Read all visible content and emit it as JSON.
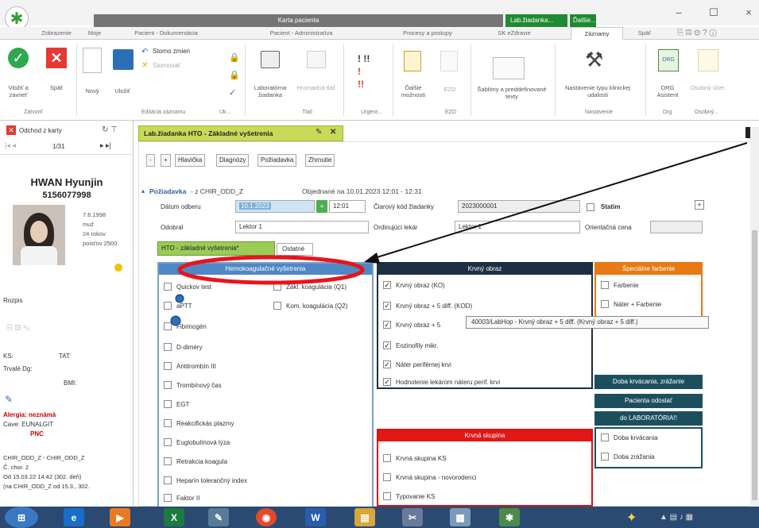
{
  "window": {
    "title": "Karta pacienta",
    "ctx_tab1": "Lab.žiadanka...",
    "ctx_tab2": "Ďalšie..."
  },
  "tabs": [
    "Zobrazenie",
    "Moje",
    "Pacient - Dokumentácia",
    "Pacient - Administratíva",
    "Procesy a postupy",
    "SK eZdravie",
    "Záznamy",
    "Späť"
  ],
  "ribbon": {
    "vlozit": "Vložiť a zavrieť",
    "spat": "Späť",
    "novy": "Nový",
    "ulozit": "Uložiť",
    "storno": "Storno zmien",
    "stornovat": "Stornovať",
    "lab_ziadanka": "Laboratórna žiadanka",
    "hromadna_tlac": "Hromadná tlač",
    "dalsie": "Ďalšie možnosti",
    "ezd": "EZD",
    "sablony": "Šablóny a preddefinované texty",
    "nastavenie": "Nastavenie typu klinickej udalosti",
    "drg": "DRG Asistent",
    "osobny": "Osobný účet",
    "grp_zatvorit": "Zatvoriť",
    "grp_editacia": "Editácia záznamu",
    "grp_tlac": "Tlač",
    "grp_urgent": "Urgent...",
    "grp_nastavenie": "Nastavenie",
    "grp_drg": "Drg",
    "grp_osobny": "Osobný..."
  },
  "left": {
    "odchod": "Odchod z karty",
    "pager": "1/31",
    "patient_name": "HWAN Hyunjin",
    "patient_id": "5156077998",
    "dob": "7.6.1998",
    "sex": "muž",
    "age": "24 rokov",
    "poistovna": "poisťov 2500",
    "rozpis": "Rozpis",
    "ks": "KS:",
    "tat": "TAT:",
    "trvale": "Trvalé Dg:",
    "bmi": "BMI:",
    "alergia": "Alergia: neznámá",
    "cave": "Cave: EUNALGIT",
    "pnc": "PNC",
    "chir1": "CHIR_ODD_Z - CHIR_ODD_Z",
    "chir2": "Č. chor. 2",
    "chir3": "Od 15.03.22 14:42 (302. deň)",
    "chir4": "(na CHIR_ODD_Z od 15.3., 302."
  },
  "doc": {
    "tab_title": "Lab.žiadanka HTO - Základné vyšetrenia",
    "subtabs": [
      "Hlavička",
      "Diagnózy",
      "Požiadavka",
      "Zhrnutie"
    ],
    "section": "Požiadavka",
    "section_from": "- z CHIR_ODD_Z",
    "objednane": "Objednané na 10.01.2023 12:01 - 12:31",
    "datum_label": "Dátum odberu",
    "datum_value": "10.1.2023",
    "time_value": "12:01",
    "ciarovy_label": "Čiarový kód žiadanky",
    "ciarovy_value": "2023000001",
    "statim": "Statim",
    "odobral_label": "Odobral",
    "odobral_value": "Lektor 1",
    "ordinujuci_label": "Ordinujúci lekár",
    "ordinujuci_value": "Lektor 1",
    "orientacna": "Orientačná cena",
    "inner_tab1": "HTO - základné vyšetrenia*",
    "inner_tab2": "Ostatné"
  },
  "koag": {
    "title": "Hemokoagulačné vyšetrenia",
    "left": [
      "Quickov test",
      "aPTT",
      "Fibrinogén",
      "D-diméry",
      "Antitrombín III",
      "Trombínový čas",
      "EGT",
      "Reakcifickás plazmy",
      "Euglobulínová lýza",
      "Retrakcia koagula",
      "Heparín tolerančný index",
      "Faktor II"
    ],
    "right": [
      "Zákl. koagulácia (Q1)",
      "Kom. koagulácia (Q2)"
    ]
  },
  "krv": {
    "title": "Krvný obraz",
    "items": [
      "Krvný obraz (KO)",
      "Krvný obraz + 5 diff. (KOD)",
      "Krvný obraz + 5",
      "Eozinofily mikr.",
      "Náter periférnej krvi",
      "Hodnotenie lekárom náteru perif. krvi"
    ],
    "tooltip": "40003/LabHop - Krvný obraz + 5 diff. (Krvný obraz + 5 diff.)"
  },
  "spec": {
    "title": "Špeciálne farbenie",
    "items": [
      "Farbenie",
      "Náter + Farbenie"
    ]
  },
  "skup": {
    "title": "Krvná skupina",
    "items": [
      "Krvná skupina KS",
      "Krvná skupina - novorodenci",
      "Typovanie KS"
    ]
  },
  "doba": {
    "h1": "Doba krvácania, zrážanie",
    "h2": "Pacienta odoslať",
    "h3": "do LABORATÓRIA!!",
    "items": [
      "Doba krvácania",
      "Doba zrážania"
    ]
  },
  "colors": {
    "accent_green": "#1f8a32",
    "annotation_red": "#e8141d",
    "koag_blue": "#4f88c4",
    "krv_navy": "#1d2f44",
    "spec_orange": "#e77a14"
  }
}
